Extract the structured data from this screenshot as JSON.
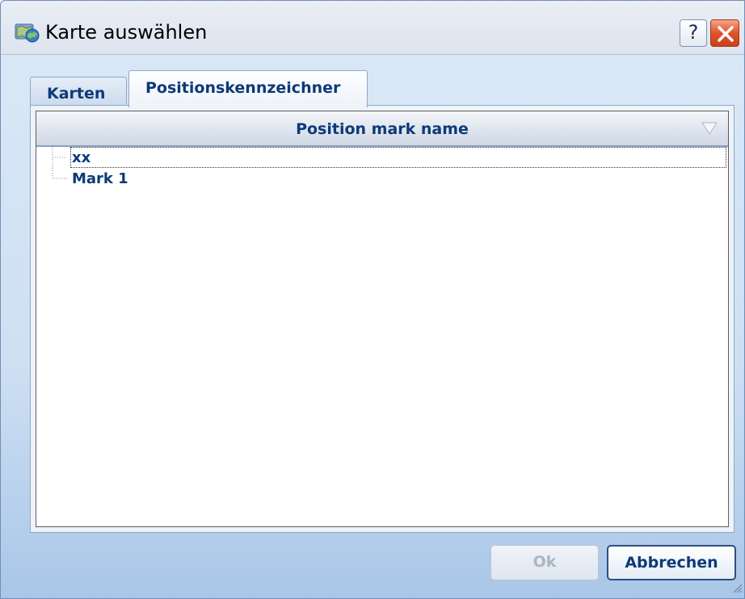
{
  "window": {
    "title": "Karte auswählen",
    "icon": "map-globe-icon",
    "help_glyph": "?",
    "close_icon": "close-icon"
  },
  "tabs": [
    {
      "label": "Karten",
      "active": false
    },
    {
      "label": "Positionskennzeichner",
      "active": true
    }
  ],
  "list": {
    "column_header": "Position mark name",
    "sort_icon": "sort-triangle-down-icon",
    "rows": [
      {
        "label": "xx",
        "selected": true
      },
      {
        "label": "Mark 1",
        "selected": false
      }
    ]
  },
  "buttons": {
    "ok_label": "Ok",
    "ok_enabled": false,
    "cancel_label": "Abbrechen"
  },
  "colors": {
    "accent_text": "#0d3a78",
    "close_red": "#e0532a",
    "disabled_text": "#a9b6c8"
  }
}
